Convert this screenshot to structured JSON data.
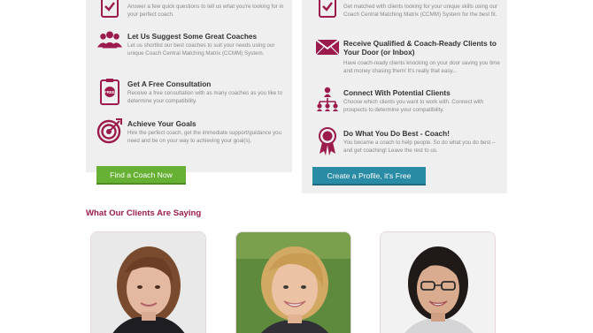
{
  "left_panel": {
    "steps": [
      {
        "icon": "clipboard-check-icon",
        "title": "",
        "description": "Answer a few quick questions to tell us what you're looking for in your perfect coach."
      },
      {
        "icon": "people-group-icon",
        "title": "Let Us Suggest Some Great Coaches",
        "description": "Let us shortlist our best coaches to suit your needs using our unique Coach Central Matching Matrix (CCMM) System."
      },
      {
        "icon": "free-tag-clipboard-icon",
        "title": "Get A Free Consultation",
        "description": "Receive a free consultation with as many coaches as you like to determine your compatibility."
      },
      {
        "icon": "target-icon",
        "title": "Achieve Your Goals",
        "description": "Hire the perfect coach, get the immediate support/guidance you need and be on your way to achieving your goal(s)."
      }
    ],
    "button_label": "Find a Coach Now"
  },
  "right_panel": {
    "steps": [
      {
        "icon": "clipboard-check-icon",
        "title": "",
        "description": "Get matched with clients looking for your unique skills using our Coach Central Matching Matrix (CCMM) System for the best fit."
      },
      {
        "icon": "envelope-icon",
        "title": "Receive Qualified & Coach-Ready Clients to Your Door (or Inbox)",
        "description": "Have coach-ready clients knocking on your door saving you time and money chasing them! It's really that easy..."
      },
      {
        "icon": "network-icon",
        "title": "Connect With Potential Clients",
        "description": "Choose which clients you want to work with. Connect with prospects to determine your compatibility."
      },
      {
        "icon": "award-ribbon-icon",
        "title": "Do What You Do Best - Coach!",
        "description": "You became a coach to help people. So do what you do best –  and get coaching! Leave the rest to us."
      }
    ],
    "button_label": "Create a Profile, it's Free"
  },
  "testimonials": {
    "heading": "What Our Clients Are Saying"
  },
  "colors": {
    "accent": "#9b1b4c",
    "green_button": "#66b034",
    "teal_button": "#2a8ba4",
    "panel_bg": "#efefef"
  }
}
